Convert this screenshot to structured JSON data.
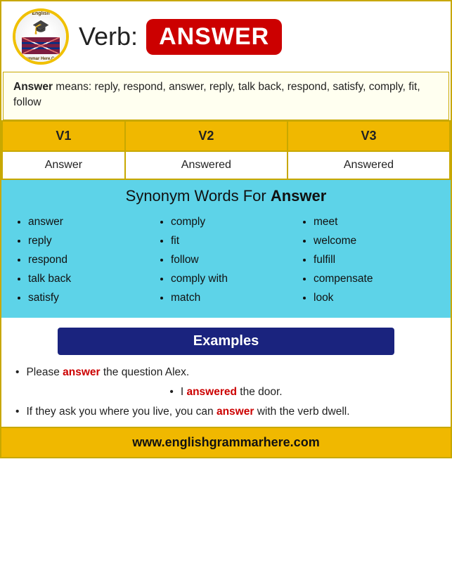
{
  "header": {
    "logo_alt": "English Grammar Here Logo",
    "logo_graduation": "🎓",
    "logo_top_text": "English",
    "logo_bottom_text": "Grammar Here.Com",
    "title_prefix": "Verb:",
    "title_word": "ANSWER"
  },
  "definition": {
    "label": "Answer",
    "text": " means: reply, respond, answer, reply, talk back, respond, satisfy, comply, fit, follow"
  },
  "verb_forms": {
    "headers": [
      "V1",
      "V2",
      "V3"
    ],
    "row": [
      "Answer",
      "Answered",
      "Answered"
    ]
  },
  "synonyms": {
    "title": "Synonym Words For ",
    "title_word": "Answer",
    "columns": [
      [
        "answer",
        "reply",
        "respond",
        "talk back",
        "satisfy"
      ],
      [
        "comply",
        "fit",
        "follow",
        "comply with",
        "match"
      ],
      [
        "meet",
        "welcome",
        "fulfill",
        "compensate",
        "look"
      ]
    ]
  },
  "examples": {
    "header": "Examples",
    "items": [
      {
        "text_before": "Please ",
        "highlight": "answer",
        "text_after": " the question Alex.",
        "centered": true
      },
      {
        "text_before": "I ",
        "highlight": "answered",
        "text_after": " the door.",
        "centered": true
      },
      {
        "text_before": "If they ask you where you live, you can ",
        "highlight": "answer",
        "text_after": " with the verb dwell.",
        "centered": true
      }
    ]
  },
  "footer": {
    "url": "www.englishgrammarhere.com"
  }
}
